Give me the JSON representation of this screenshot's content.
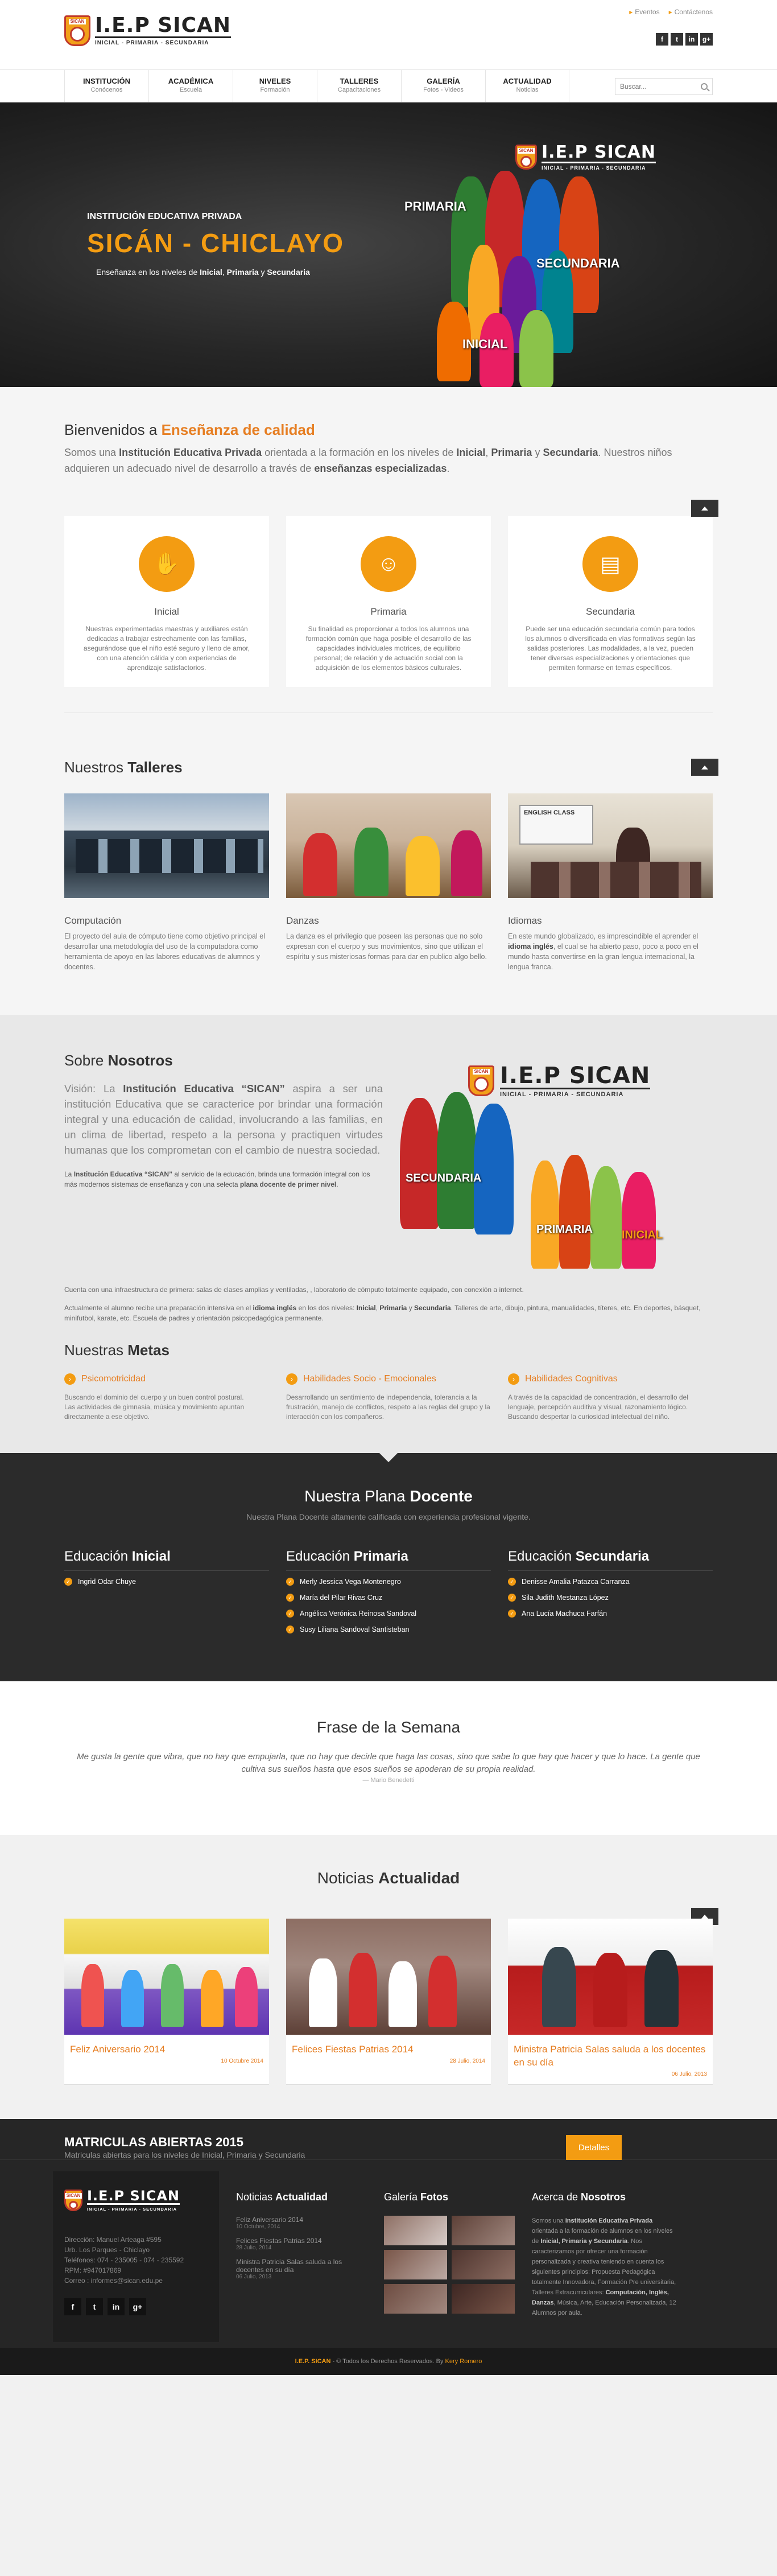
{
  "brand": {
    "name": "I.E.P SICAN",
    "tagline": "INICIAL - PRIMARIA - SECUNDARIA",
    "badge": "SICAN"
  },
  "top_links": [
    "Eventos",
    "Contáctenos"
  ],
  "social": [
    "f",
    "t",
    "in",
    "g+"
  ],
  "nav": [
    {
      "title": "Institución",
      "sub": "Conócenos"
    },
    {
      "title": "Académica",
      "sub": "Escuela"
    },
    {
      "title": "Niveles",
      "sub": "Formación"
    },
    {
      "title": "Talleres",
      "sub": "Capacitaciones"
    },
    {
      "title": "Galería",
      "sub": "Fotos - Videos"
    },
    {
      "title": "Actualidad",
      "sub": "Noticias"
    }
  ],
  "search": {
    "placeholder": "Buscar..."
  },
  "hero": {
    "small": "Institución Educativa Privada",
    "big": "SICÁN - CHICLAYO",
    "desc_pre": "Enseñanza en los niveles de ",
    "desc_b1": "Inicial",
    "desc_mid": ", ",
    "desc_b2": "Primaria",
    "desc_and": " y ",
    "desc_b3": "Secundaria",
    "labels": [
      "PRIMARIA",
      "SECUNDARIA",
      "INICIAL"
    ]
  },
  "welcome": {
    "title_pre": "Bienvenidos a ",
    "title_b": "Enseñanza de calidad",
    "l1": "Somos una ",
    "l2": "Institución Educativa Privada",
    "l3": " orientada a la formación en los niveles de ",
    "l4": "Inicial",
    "l5": ", ",
    "l6": "Primaria",
    "l7": " y ",
    "l8": "Secundaria",
    "l9": ". Nuestros niños adquieren un adecuado nivel de desarrollo a través de ",
    "l10": "enseñanzas especializadas",
    "l11": "."
  },
  "levels": [
    {
      "title": "Inicial",
      "icon": "child-icon",
      "text": "Nuestras experimentadas maestras y auxiliares están dedicadas a trabajar estrechamente con las familias, asegurándose que el niño esté seguro y lleno de amor, con una atención cálida y con experiencias de aprendizaje satisfactorios."
    },
    {
      "title": "Primaria",
      "icon": "group-icon",
      "text": "Su finalidad es proporcionar a todos los alumnos una formación común que haga posible el desarrollo de las capacidades individuales motrices, de equilibrio personal; de relación y de actuación social con la adquisición de los elementos básicos culturales."
    },
    {
      "title": "Secundaria",
      "icon": "book-icon",
      "text": "Puede ser una educación secundaria común para todos los alumnos o diversificada en vías formativas según las salidas posteriores. Las modalidades, a la vez, pueden tener diversas especializaciones y orientaciones que permiten formarse en temas específicos."
    }
  ],
  "talleres": {
    "title_pre": "Nuestros ",
    "title_b": "Talleres",
    "items": [
      {
        "title": "Computación",
        "text": "El proyecto del aula de cómputo tiene como objetivo principal el desarrollar una metodología del uso de la computadora como herramienta de apoyo en las labores educativas de alumnos y docentes."
      },
      {
        "title": "Danzas",
        "text": "La danza es el privilegio que poseen las personas que no solo expresan con el cuerpo y sus movimientos, sino que utilizan el espíritu y sus misteriosas formas para dar en publico algo bello."
      },
      {
        "title": "Idiomas",
        "t1": "En este mundo globalizado, es imprescindible el aprender el ",
        "tb": "idioma inglés",
        "t2": ", el cual se ha abierto paso, poco a poco en el mundo hasta convertirse en la gran lengua internacional, la lengua franca.",
        "board": "ENGLISH CLASS"
      }
    ]
  },
  "sobre": {
    "title_pre": "Sobre ",
    "title_b": "Nosotros",
    "v1": "Visión: La ",
    "v2": "Institución Educativa “SICAN”",
    "v3": " aspira a ser una institución Educativa que se caracterice por brindar una formación integral y una educación de calidad, involucrando a las familias, en un clima de libertad, respeto a la persona y practiquen virtudes humanas que los comprometan con el cambio de nuestra sociedad.",
    "s1": "La ",
    "s2": "Institución Educativa “SICAN”",
    "s3": " al servicio de la educación, brinda una formación integral con los más modernos sistemas de enseñanza y con una selecta ",
    "s4": "plana docente de primer nivel",
    "s5": ".",
    "w1": "Cuenta con una infraestructura de primera: salas de clases amplias y ventiladas, , laboratorio de cómputo totalmente equipado, con conexión a internet.",
    "w2a": "Actualmente el alumno recibe una preparación intensiva en el ",
    "w2b": "idioma inglés",
    "w2c": " en los dos niveles: ",
    "w2d": "Inicial",
    "w2e": ", ",
    "w2f": "Primaria",
    "w2g": " y ",
    "w2h": "Secundaria",
    "w2i": ". Talleres de arte, dibujo, pintura, manualidades, títeres, etc. En deportes, básquet, minifutbol, karate, etc. Escuela de padres y orientación psicopedagógica permanente.",
    "labels": [
      "SECUNDARIA",
      "PRIMARIA",
      "INICIAL"
    ]
  },
  "metas": {
    "title_pre": "Nuestras ",
    "title_b": "Metas",
    "items": [
      {
        "title": "Psicomotricidad",
        "text1": "Buscando el dominio del cuerpo y un buen control postural.",
        "text2": "Las actividades de gimnasia, música y movimiento apuntan directamente a ese objetivo."
      },
      {
        "title": "Habilidades Socio - Emocionales",
        "text1": "Desarrollando un sentimiento de independencia, tolerancia a la frustración, manejo de conflictos, respeto a las reglas del grupo y la interacción con los compañeros.",
        "text2": ""
      },
      {
        "title": "Habilidades Cognitivas",
        "text1": "A través de la capacidad de concentración, el desarrollo del lenguaje, percepción auditiva y visual, razonamiento lógico. Buscando despertar la curiosidad intelectual del niño.",
        "text2": ""
      }
    ]
  },
  "docente": {
    "title_pre": "Nuestra Plana ",
    "title_b": "Docente",
    "sub": "Nuestra Plana Docente altamente calificada con experiencia profesional vigente.",
    "cols": [
      {
        "pre": "Educación ",
        "b": "Inicial",
        "names": [
          "Ingrid Odar Chuye"
        ]
      },
      {
        "pre": "Educación ",
        "b": "Primaria",
        "names": [
          "Merly Jessica Vega Montenegro",
          "María del Pilar Rivas Cruz",
          "Angélica Verónica Reinosa Sandoval",
          "Susy Liliana Sandoval Santisteban"
        ]
      },
      {
        "pre": "Educación ",
        "b": "Secundaria",
        "names": [
          "Denisse Amalia Patazca Carranza",
          "Sila Judith Mestanza López",
          "Ana Lucía Machuca Farfán"
        ]
      }
    ]
  },
  "frase": {
    "title": "Frase de la Semana",
    "quote": "Me gusta la gente que vibra, que no hay que empujarla, que no hay que decirle que haga las cosas, sino que sabe lo que hay que hacer y que lo hace. La gente que cultiva sus sueños hasta que esos sueños se apoderan de su propia realidad.",
    "author": "— Mario Benedetti"
  },
  "noticias": {
    "title_pre": "Noticias ",
    "title_b": "Actualidad",
    "items": [
      {
        "title": "Feliz Aniversario 2014",
        "date": "10 Octubre 2014"
      },
      {
        "title": "Felices Fiestas Patrias 2014",
        "date": "28 Julio, 2014"
      },
      {
        "title": "Ministra Patricia Salas saluda a los docentes en su día",
        "date": "06 Julio, 2013"
      }
    ]
  },
  "matriculas": {
    "title": "MATRICULAS ABIERTAS 2015",
    "sub": "Matriculas abiertas para los niveles de Inicial, Primaria y Secundaria",
    "button": "Detalles"
  },
  "footer": {
    "addr": [
      "Dirección: Manuel Arteaga #595",
      "Urb. Los Parques - Chiclayo",
      "Teléfonos: 074 - 235005 - 074 - 235592",
      "RPM: #947017869",
      "Correo : informes@sican.edu.pe"
    ],
    "news_title_pre": "Noticias ",
    "news_title_b": "Actualidad",
    "news": [
      {
        "t": "Feliz Aniversario 2014",
        "d": "10 Octubre, 2014"
      },
      {
        "t": "Felices Fiestas Patrias 2014",
        "d": "28 Julio, 2014"
      },
      {
        "t": "Ministra Patricia Salas saluda a los docentes en su día",
        "d": "06 Julio, 2013"
      }
    ],
    "gal_pre": "Galería ",
    "gal_b": "Fotos",
    "about_pre": "Acerca de ",
    "about_b": "Nosotros",
    "a1": "Somos una ",
    "a2": "Institución Educativa Privada",
    "a3": " orientada a la formación de alumnos en los niveles de ",
    "a4": "Inicial, Primaria y Secundaria",
    "a5": ". Nos caracterizamos por ofrecer una formación personalizada y creativa teniendo en cuenta los siguientes principios: Propuesta Pedagógica totalmente Innovadora, Formación Pre universitaria, Talleres Extracurriculares: ",
    "a6": "Computación, Inglés, Danzas",
    "a7": ", Música, Arte, Educación Personalizada, 12 Alumnos por aula.",
    "copy_b": "I.E.P. SICAN",
    "copy_1": " - © Todos los Derechos Reservados. By ",
    "copy_2": "Kery Romero"
  }
}
